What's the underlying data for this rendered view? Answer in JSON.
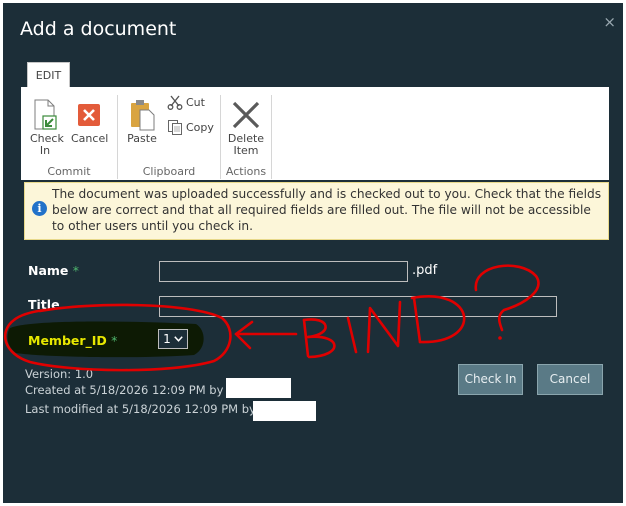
{
  "dialog": {
    "title": "Add a document",
    "close_glyph": "×"
  },
  "ribbon": {
    "tab_label": "EDIT",
    "commit": {
      "group_label": "Commit",
      "check_in_line1": "Check",
      "check_in_line2": "In",
      "cancel_label": "Cancel"
    },
    "clipboard": {
      "group_label": "Clipboard",
      "paste_label": "Paste",
      "cut_label": "Cut",
      "copy_label": "Copy"
    },
    "actions": {
      "group_label": "Actions",
      "delete_line1": "Delete",
      "delete_line2": "Item"
    }
  },
  "notice": {
    "text": "The document was uploaded successfully and is checked out to you. Check that the fields below are correct and that all required fields are filled out. The file will not be accessible to other users until you check in.",
    "icon_glyph": "i"
  },
  "form": {
    "name_label": "Name",
    "name_suffix": ".pdf",
    "title_label": "Title",
    "member_label": "Member_ID",
    "member_value": "1",
    "required_mark": "*"
  },
  "meta": {
    "version": "Version: 1.0",
    "created": "Created at 5/18/2026 12:09 PM  by",
    "modified": "Last modified at 5/18/2026 12:09 PM  by"
  },
  "buttons": {
    "check_in": "Check In",
    "cancel": "Cancel"
  },
  "colors": {
    "dialog_bg": "#1c2e38",
    "annotation_red": "#e00000",
    "highlight_black": "#0d1a04",
    "member_label": "#e8e800"
  }
}
